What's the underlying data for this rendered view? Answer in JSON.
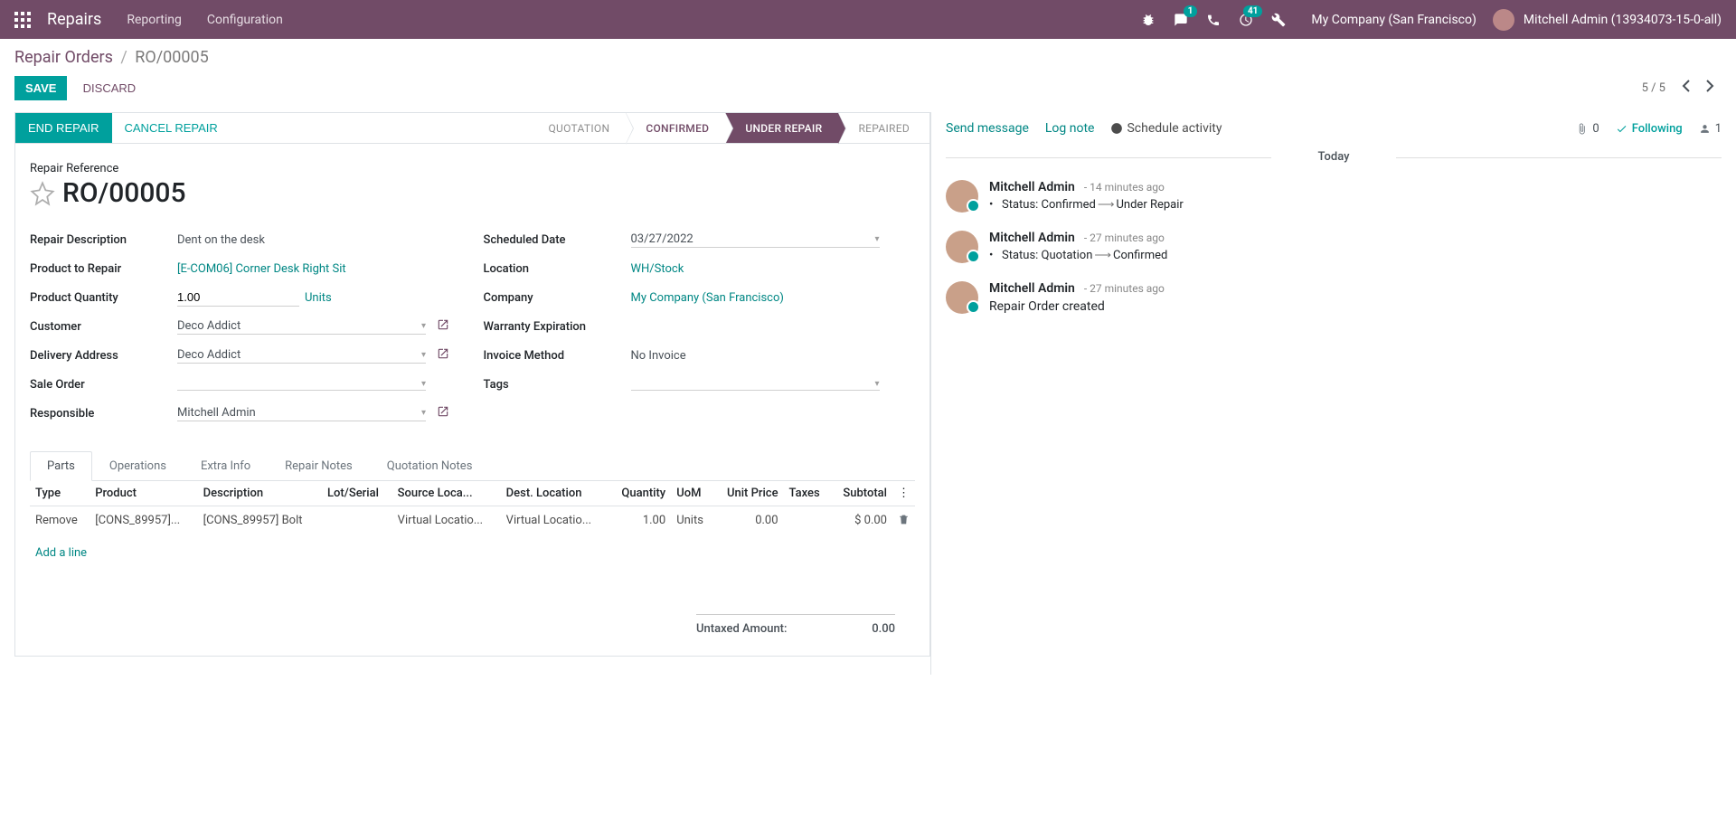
{
  "navbar": {
    "brand": "Repairs",
    "menu": [
      "Reporting",
      "Configuration"
    ],
    "messaging_count": "1",
    "activities_count": "41",
    "company": "My Company (San Francisco)",
    "user": "Mitchell Admin (13934073-15-0-all)"
  },
  "breadcrumbs": {
    "root": "Repair Orders",
    "current": "RO/00005"
  },
  "cp": {
    "save": "SAVE",
    "discard": "DISCARD",
    "pager": "5 / 5"
  },
  "statusbar": {
    "end_repair": "END REPAIR",
    "cancel_repair": "CANCEL REPAIR",
    "stages": [
      "QUOTATION",
      "CONFIRMED",
      "UNDER REPAIR",
      "REPAIRED"
    ]
  },
  "record": {
    "ref_label": "Repair Reference",
    "name": "RO/00005",
    "fields": {
      "repair_description": {
        "label": "Repair Description",
        "value": "Dent on the desk"
      },
      "product_to_repair": {
        "label": "Product to Repair",
        "value": "[E-COM06] Corner Desk Right Sit"
      },
      "product_quantity": {
        "label": "Product Quantity",
        "value": "1.00",
        "uom": "Units"
      },
      "customer": {
        "label": "Customer",
        "value": "Deco Addict"
      },
      "delivery_address": {
        "label": "Delivery Address",
        "value": "Deco Addict"
      },
      "sale_order": {
        "label": "Sale Order",
        "value": ""
      },
      "responsible": {
        "label": "Responsible",
        "value": "Mitchell Admin"
      },
      "scheduled_date": {
        "label": "Scheduled Date",
        "value": "03/27/2022"
      },
      "location": {
        "label": "Location",
        "value": "WH/Stock"
      },
      "company": {
        "label": "Company",
        "value": "My Company (San Francisco)"
      },
      "warranty_expiration": {
        "label": "Warranty Expiration",
        "value": ""
      },
      "invoice_method": {
        "label": "Invoice Method",
        "value": "No Invoice"
      },
      "tags": {
        "label": "Tags",
        "value": ""
      }
    }
  },
  "tabs": [
    "Parts",
    "Operations",
    "Extra Info",
    "Repair Notes",
    "Quotation Notes"
  ],
  "parts": {
    "columns": [
      "Type",
      "Product",
      "Description",
      "Lot/Serial",
      "Source Loca...",
      "Dest. Location",
      "Quantity",
      "UoM",
      "Unit Price",
      "Taxes",
      "Subtotal"
    ],
    "rows": [
      {
        "type": "Remove",
        "product": "[CONS_89957]...",
        "description": "[CONS_89957] Bolt",
        "lot": "",
        "src": "Virtual Locatio...",
        "dest": "Virtual Locatio...",
        "qty": "1.00",
        "uom": "Units",
        "unit_price": "0.00",
        "taxes": "",
        "subtotal": "$ 0.00"
      }
    ],
    "add_line": "Add a line"
  },
  "totals": {
    "untaxed_label": "Untaxed Amount:",
    "untaxed_value": "0.00"
  },
  "chatter": {
    "send_message": "Send message",
    "log_note": "Log note",
    "schedule_activity": "Schedule activity",
    "attachments": "0",
    "following": "Following",
    "followers": "1",
    "today": "Today",
    "messages": [
      {
        "author": "Mitchell Admin",
        "time": "- 14 minutes ago",
        "status_from": "Status: Confirmed",
        "status_to": "Under Repair"
      },
      {
        "author": "Mitchell Admin",
        "time": "- 27 minutes ago",
        "status_from": "Status: Quotation",
        "status_to": "Confirmed"
      },
      {
        "author": "Mitchell Admin",
        "time": "- 27 minutes ago",
        "plain": "Repair Order created"
      }
    ]
  }
}
